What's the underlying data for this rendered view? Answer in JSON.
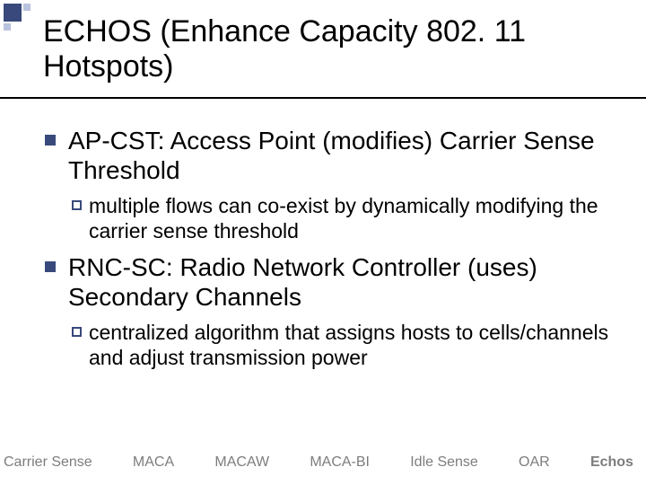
{
  "title": "ECHOS (Enhance Capacity 802. 11 Hotspots)",
  "bullets": [
    {
      "text": "AP-CST: Access Point (modifies) Carrier Sense Threshold",
      "sub": [
        {
          "text": "multiple flows can co-exist by dynamically modifying the carrier sense threshold"
        }
      ]
    },
    {
      "text": "RNC-SC: Radio Network Controller (uses) Secondary Channels",
      "sub": [
        {
          "text": "centralized algorithm that assigns hosts to cells/channels and adjust transmission power"
        }
      ]
    }
  ],
  "footer": [
    {
      "label": "Carrier Sense",
      "active": false
    },
    {
      "label": "MACA",
      "active": false
    },
    {
      "label": "MACAW",
      "active": false
    },
    {
      "label": "MACA-BI",
      "active": false
    },
    {
      "label": "Idle Sense",
      "active": false
    },
    {
      "label": "OAR",
      "active": false
    },
    {
      "label": "Echos",
      "active": true
    }
  ]
}
